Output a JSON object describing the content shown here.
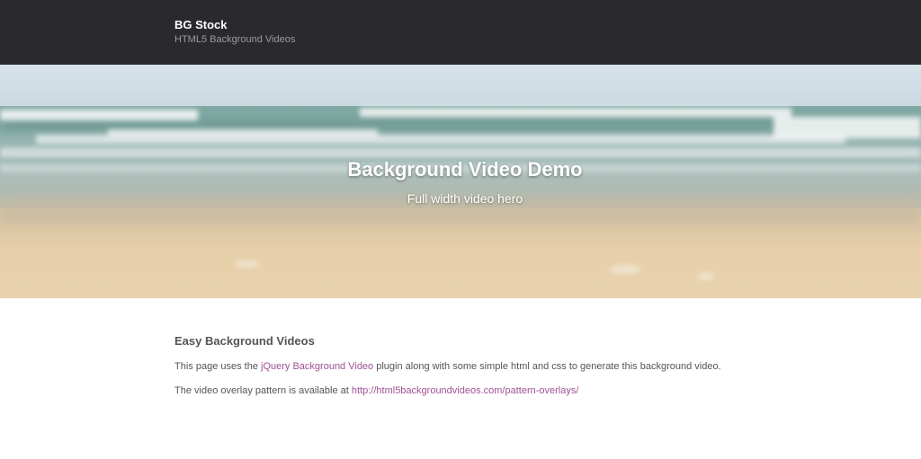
{
  "header": {
    "brand": "BG Stock",
    "tagline": "HTML5 Background Videos"
  },
  "hero": {
    "title": "Background Video Demo",
    "subtitle": "Full width video hero"
  },
  "content": {
    "heading": "Easy Background Videos",
    "p1_before": "This page uses the ",
    "p1_link": "jQuery Background Video",
    "p1_after": " plugin along with some simple html and css to generate this background video.",
    "p2_before": "The video overlay pattern is available at ",
    "p2_link": "http://html5backgroundvideos.com/pattern-overlays/"
  },
  "colors": {
    "header_bg": "#2a2a2e",
    "link": "#a05294",
    "text": "#555558"
  }
}
